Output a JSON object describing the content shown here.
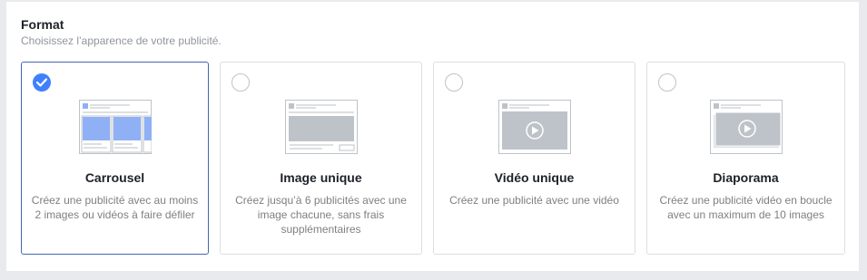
{
  "section": {
    "title": "Format",
    "subtitle": "Choisissez l’apparence de votre publicité."
  },
  "formats": [
    {
      "name": "Carrousel",
      "description": "Créez une publicité avec au moins 2 images ou vidéos à faire défiler",
      "selected": true,
      "icon": "carousel-icon"
    },
    {
      "name": "Image unique",
      "description": "Créez jusqu’à 6 publicités avec une image chacune, sans frais supplémentaires",
      "selected": false,
      "icon": "single-image-icon"
    },
    {
      "name": "Vidéo unique",
      "description": "Créez une publicité avec une vidéo",
      "selected": false,
      "icon": "single-video-icon"
    },
    {
      "name": "Diaporama",
      "description": "Créez une publicité vidéo en boucle avec un maximum de 10 images",
      "selected": false,
      "icon": "slideshow-icon"
    }
  ],
  "colors": {
    "accent": "#4080ff",
    "selected_border": "#4267b2",
    "carousel_fill": "#8fb0f5",
    "placeholder_fill": "#bec3c9"
  }
}
